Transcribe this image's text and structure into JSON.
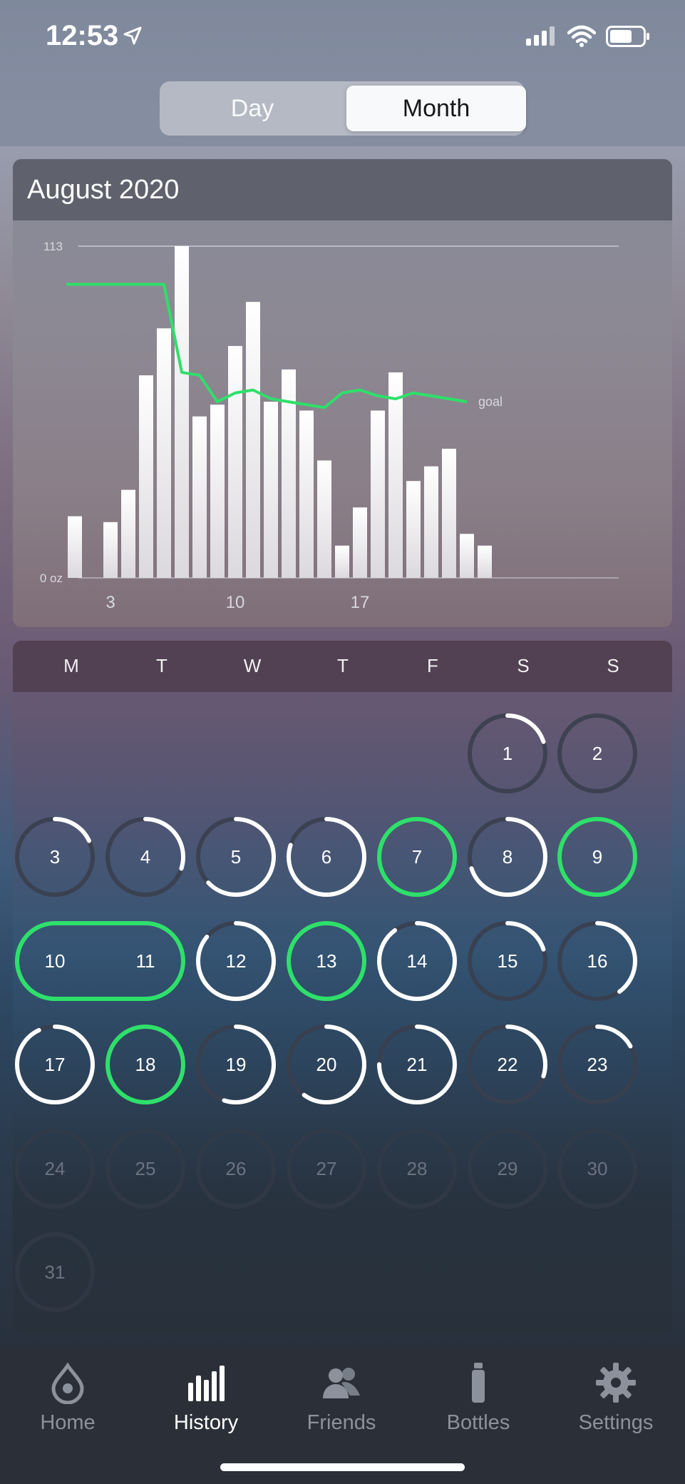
{
  "status_bar": {
    "time": "12:53"
  },
  "segmented": {
    "day_label": "Day",
    "month_label": "Month",
    "selected": "Month"
  },
  "chart_card": {
    "title": "August 2020"
  },
  "chart_data": {
    "type": "bar",
    "x": [
      1,
      2,
      3,
      4,
      5,
      6,
      7,
      8,
      9,
      10,
      11,
      12,
      13,
      14,
      15,
      16,
      17,
      18,
      19,
      20,
      21,
      22,
      23
    ],
    "values": [
      21,
      0,
      19,
      30,
      69,
      85,
      113,
      55,
      59,
      79,
      94,
      60,
      71,
      57,
      40,
      11,
      24,
      57,
      70,
      33,
      38,
      44,
      15,
      11
    ],
    "ylim": [
      0,
      113
    ],
    "ytick_top_label": "113",
    "ytick_bottom_label": "0 oz",
    "xtick_labels": [
      "3",
      "10",
      "17"
    ],
    "xtick_values": [
      3,
      10,
      17
    ],
    "goal_label": "goal",
    "goal_series": [
      100,
      100,
      100,
      100,
      100,
      100,
      70,
      69,
      60,
      63,
      64,
      61,
      60,
      59,
      58,
      63,
      64,
      62,
      61,
      63,
      62,
      61,
      60
    ],
    "bar_color": "#f3f3f5",
    "goal_color": "#2ee06a"
  },
  "calendar": {
    "weekdays": [
      "M",
      "T",
      "W",
      "T",
      "F",
      "S",
      "S"
    ],
    "days": [
      {
        "day": "1",
        "progress": 0.2,
        "goal": false,
        "future": false
      },
      {
        "day": "2",
        "progress": 0.0,
        "goal": false,
        "future": false
      },
      {
        "day": "3",
        "progress": 0.18,
        "goal": false,
        "future": false
      },
      {
        "day": "4",
        "progress": 0.3,
        "goal": false,
        "future": false
      },
      {
        "day": "5",
        "progress": 0.63,
        "goal": false,
        "future": false
      },
      {
        "day": "6",
        "progress": 0.8,
        "goal": false,
        "future": false
      },
      {
        "day": "7",
        "progress": 1.0,
        "goal": true,
        "future": false
      },
      {
        "day": "8",
        "progress": 0.7,
        "goal": false,
        "future": false
      },
      {
        "day": "9",
        "progress": 1.0,
        "goal": true,
        "future": false
      },
      {
        "day": "10",
        "progress": 1.0,
        "goal": true,
        "future": false
      },
      {
        "day": "11",
        "progress": 1.0,
        "goal": true,
        "future": false
      },
      {
        "day": "12",
        "progress": 0.86,
        "goal": false,
        "future": false
      },
      {
        "day": "13",
        "progress": 1.0,
        "goal": true,
        "future": false
      },
      {
        "day": "14",
        "progress": 0.9,
        "goal": false,
        "future": false
      },
      {
        "day": "15",
        "progress": 0.2,
        "goal": false,
        "future": false
      },
      {
        "day": "16",
        "progress": 0.4,
        "goal": false,
        "future": false
      },
      {
        "day": "17",
        "progress": 0.93,
        "goal": false,
        "future": false
      },
      {
        "day": "18",
        "progress": 1.0,
        "goal": true,
        "future": false
      },
      {
        "day": "19",
        "progress": 0.55,
        "goal": false,
        "future": false
      },
      {
        "day": "20",
        "progress": 0.6,
        "goal": false,
        "future": false
      },
      {
        "day": "21",
        "progress": 0.75,
        "goal": false,
        "future": false
      },
      {
        "day": "22",
        "progress": 0.3,
        "goal": false,
        "future": false
      },
      {
        "day": "23",
        "progress": 0.17,
        "goal": false,
        "future": false
      },
      {
        "day": "24",
        "progress": 0.0,
        "goal": false,
        "future": true
      },
      {
        "day": "25",
        "progress": 0.0,
        "goal": false,
        "future": true
      },
      {
        "day": "26",
        "progress": 0.0,
        "goal": false,
        "future": true
      },
      {
        "day": "27",
        "progress": 0.0,
        "goal": false,
        "future": true
      },
      {
        "day": "28",
        "progress": 0.0,
        "goal": false,
        "future": true
      },
      {
        "day": "29",
        "progress": 0.0,
        "goal": false,
        "future": true
      },
      {
        "day": "30",
        "progress": 0.0,
        "goal": false,
        "future": true
      },
      {
        "day": "31",
        "progress": 0.0,
        "goal": false,
        "future": true
      }
    ],
    "streak_days": [
      "10",
      "11"
    ]
  },
  "tabs": [
    {
      "label": "Home",
      "icon": "drop-icon",
      "active": false
    },
    {
      "label": "History",
      "icon": "bar-chart-icon",
      "active": true
    },
    {
      "label": "Friends",
      "icon": "people-icon",
      "active": false
    },
    {
      "label": "Bottles",
      "icon": "bottle-icon",
      "active": false
    },
    {
      "label": "Settings",
      "icon": "gear-icon",
      "active": false
    }
  ],
  "colors": {
    "accent_green": "#2ee06a",
    "white_ring": "#ffffff",
    "empty_ring": "#3a3f4a"
  }
}
